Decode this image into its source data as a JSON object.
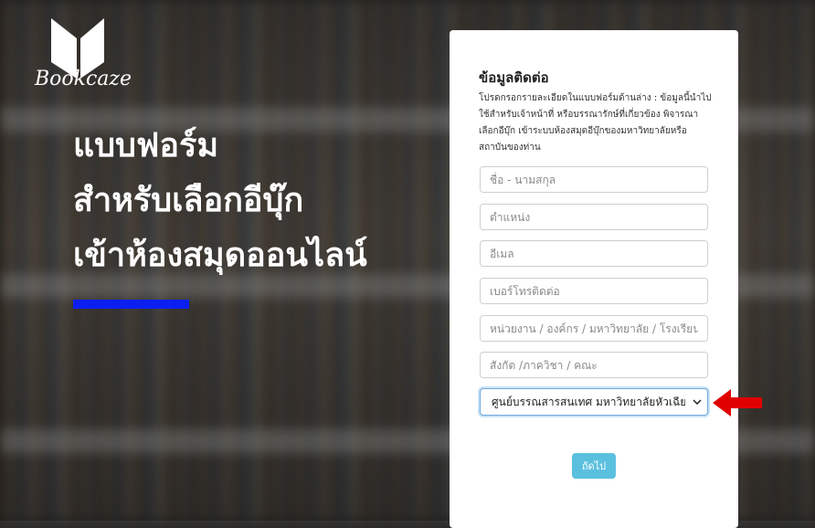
{
  "brand": {
    "name": "Bookcaze"
  },
  "hero": {
    "line1": "แบบฟอร์ม",
    "line2": "สำหรับเลือกอีบุ๊ก",
    "line3": "เข้าห้องสมุดออนไลน์",
    "bar_color": "#0b1ff0"
  },
  "form": {
    "title": "ข้อมูลติดต่อ",
    "description": "โปรดกรอกรายละเอียดในแบบฟอร์มด้านล่าง : ข้อมูลนี้นำไปใช้สำหรับเจ้าหน้าที่ หรือบรรณารักษ์ที่เกี่ยวข้อง พิจารณาเลือกอีบุ๊ก เข้าระบบห้องสมุดอีบุ๊กของมหาวิทยาลัยหรือสถาบันของท่าน",
    "fields": {
      "name_placeholder": "ชื่อ - นามสกุล",
      "position_placeholder": "ตำแหน่ง",
      "email_placeholder": "อีเมล",
      "phone_placeholder": "เบอร์โทรติดต่อ",
      "org_placeholder": "หน่วยงาน / องค์กร / มหาวิทยาลัย / โรงเรียน",
      "dept_placeholder": "สังกัด /ภาควิชา / คณะ"
    },
    "library_select": {
      "value": "ศูนย์บรรณสารสนเทศ มหาวิทยาลัยหัวเฉียวเ"
    },
    "next_label": "ถัดไป",
    "next_color": "#5bc0de"
  },
  "annotation": {
    "arrow_color": "#e00000"
  }
}
